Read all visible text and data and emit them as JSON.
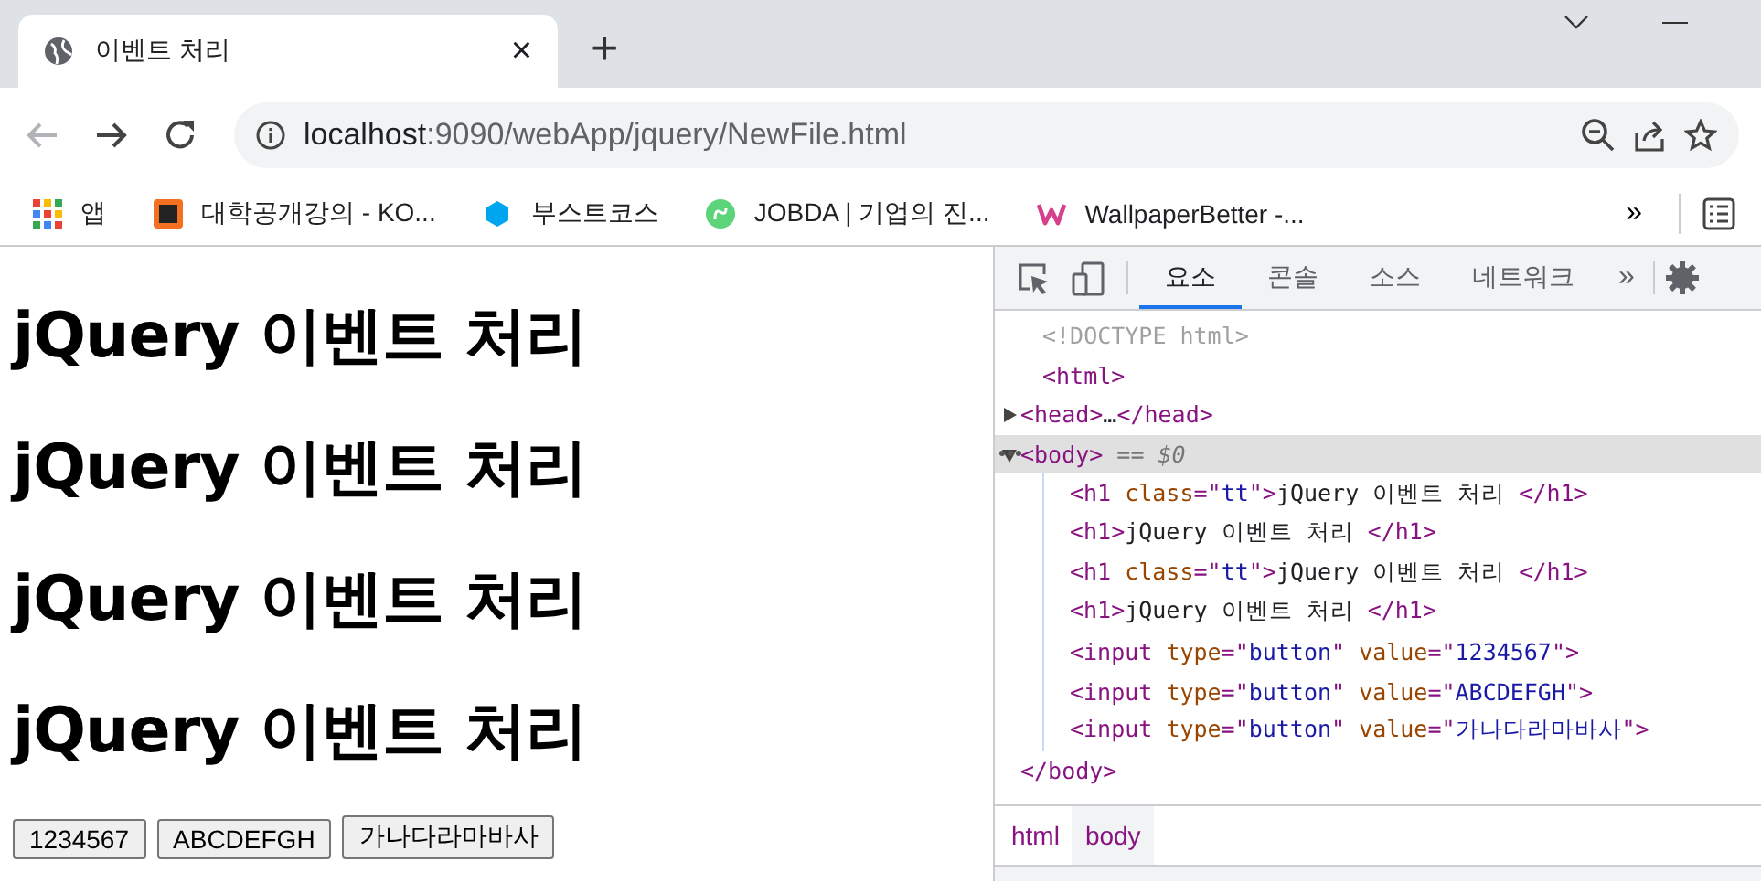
{
  "browser": {
    "tab": {
      "title": "이벤트 처리",
      "close": "×"
    },
    "new_tab": "+",
    "url": {
      "host": "localhost",
      "rest": ":9090/webApp/jquery/NewFile.html"
    },
    "bookmarks": [
      {
        "label": "앱"
      },
      {
        "label": "대학공개강의 - KO..."
      },
      {
        "label": "부스트코스"
      },
      {
        "label": "JOBDA | 기업의 진..."
      },
      {
        "label": "WallpaperBetter -..."
      }
    ],
    "bookmarks_overflow": "»"
  },
  "page": {
    "headings": [
      "jQuery 이벤트 처리",
      "jQuery 이벤트 처리",
      "jQuery 이벤트 처리",
      "jQuery 이벤트 처리"
    ],
    "buttons": [
      "1234567",
      "ABCDEFGH",
      "가나다라마바사"
    ]
  },
  "devtools": {
    "tabs": [
      {
        "label": "요소",
        "selected": true
      },
      {
        "label": "콘솔",
        "selected": false
      },
      {
        "label": "소스",
        "selected": false
      },
      {
        "label": "네트워크",
        "selected": false
      }
    ],
    "tabs_overflow": "»",
    "dom": [
      {
        "segments": [
          {
            "kind": "doctype",
            "text": "<!DOCTYPE html>"
          }
        ],
        "selected": false
      },
      {
        "segments": [
          {
            "kind": "tag",
            "text": "<html>"
          }
        ],
        "selected": false,
        "children": [
          {
            "segments": [
              {
                "kind": "tag",
                "text": "<head>"
              },
              {
                "kind": "text",
                "text": "…"
              },
              {
                "kind": "tag",
                "text": "</head>"
              }
            ],
            "selected": false,
            "expanded": false
          },
          {
            "segments": [
              {
                "kind": "tag",
                "text": "<body>"
              },
              {
                "kind": "hint",
                "text": " == $0"
              }
            ],
            "selected": true,
            "expanded": true,
            "children": [
              {
                "segments": [
                  {
                    "kind": "tag",
                    "text": "<h1 "
                  },
                  {
                    "kind": "attr",
                    "text": "class"
                  },
                  {
                    "kind": "tag",
                    "text": "=\""
                  },
                  {
                    "kind": "value",
                    "text": "tt"
                  },
                  {
                    "kind": "tag",
                    "text": "\">"
                  },
                  {
                    "kind": "text",
                    "text": "jQuery 이벤트 처리 "
                  },
                  {
                    "kind": "tag",
                    "text": "</h1>"
                  }
                ],
                "selected": false
              },
              {
                "segments": [
                  {
                    "kind": "tag",
                    "text": "<h1>"
                  },
                  {
                    "kind": "text",
                    "text": "jQuery 이벤트 처리 "
                  },
                  {
                    "kind": "tag",
                    "text": "</h1>"
                  }
                ],
                "selected": false
              },
              {
                "segments": [
                  {
                    "kind": "tag",
                    "text": "<h1 "
                  },
                  {
                    "kind": "attr",
                    "text": "class"
                  },
                  {
                    "kind": "tag",
                    "text": "=\""
                  },
                  {
                    "kind": "value",
                    "text": "tt"
                  },
                  {
                    "kind": "tag",
                    "text": "\">"
                  },
                  {
                    "kind": "text",
                    "text": "jQuery 이벤트 처리 "
                  },
                  {
                    "kind": "tag",
                    "text": "</h1>"
                  }
                ],
                "selected": false
              },
              {
                "segments": [
                  {
                    "kind": "tag",
                    "text": "<h1>"
                  },
                  {
                    "kind": "text",
                    "text": "jQuery 이벤트 처리 "
                  },
                  {
                    "kind": "tag",
                    "text": "</h1>"
                  }
                ],
                "selected": false
              },
              {
                "segments": [
                  {
                    "kind": "tag",
                    "text": "<input "
                  },
                  {
                    "kind": "attr",
                    "text": "type"
                  },
                  {
                    "kind": "tag",
                    "text": "=\""
                  },
                  {
                    "kind": "value",
                    "text": "button"
                  },
                  {
                    "kind": "tag",
                    "text": "\" "
                  },
                  {
                    "kind": "attr",
                    "text": "value"
                  },
                  {
                    "kind": "tag",
                    "text": "=\""
                  },
                  {
                    "kind": "value2",
                    "text": "1234567"
                  },
                  {
                    "kind": "tag",
                    "text": "\">"
                  }
                ],
                "selected": false
              },
              {
                "segments": [
                  {
                    "kind": "tag",
                    "text": "<input "
                  },
                  {
                    "kind": "attr",
                    "text": "type"
                  },
                  {
                    "kind": "tag",
                    "text": "=\""
                  },
                  {
                    "kind": "value",
                    "text": "button"
                  },
                  {
                    "kind": "tag",
                    "text": "\" "
                  },
                  {
                    "kind": "attr",
                    "text": "value"
                  },
                  {
                    "kind": "tag",
                    "text": "=\""
                  },
                  {
                    "kind": "value2",
                    "text": "ABCDEFGH"
                  },
                  {
                    "kind": "tag",
                    "text": "\">"
                  }
                ],
                "selected": false
              },
              {
                "segments": [
                  {
                    "kind": "tag",
                    "text": "<input "
                  },
                  {
                    "kind": "attr",
                    "text": "type"
                  },
                  {
                    "kind": "tag",
                    "text": "=\""
                  },
                  {
                    "kind": "value",
                    "text": "button"
                  },
                  {
                    "kind": "tag",
                    "text": "\" "
                  },
                  {
                    "kind": "attr",
                    "text": "value"
                  },
                  {
                    "kind": "tag",
                    "text": "=\""
                  },
                  {
                    "kind": "value2",
                    "text": "가나다라마바사"
                  },
                  {
                    "kind": "tag",
                    "text": "\">"
                  }
                ],
                "selected": false
              }
            ]
          },
          {
            "segments": [
              {
                "kind": "tag",
                "text": "</body>"
              }
            ],
            "selected": false
          }
        ]
      }
    ],
    "breadcrumbs": [
      {
        "label": "html",
        "selected": false
      },
      {
        "label": "body",
        "selected": true
      }
    ]
  }
}
